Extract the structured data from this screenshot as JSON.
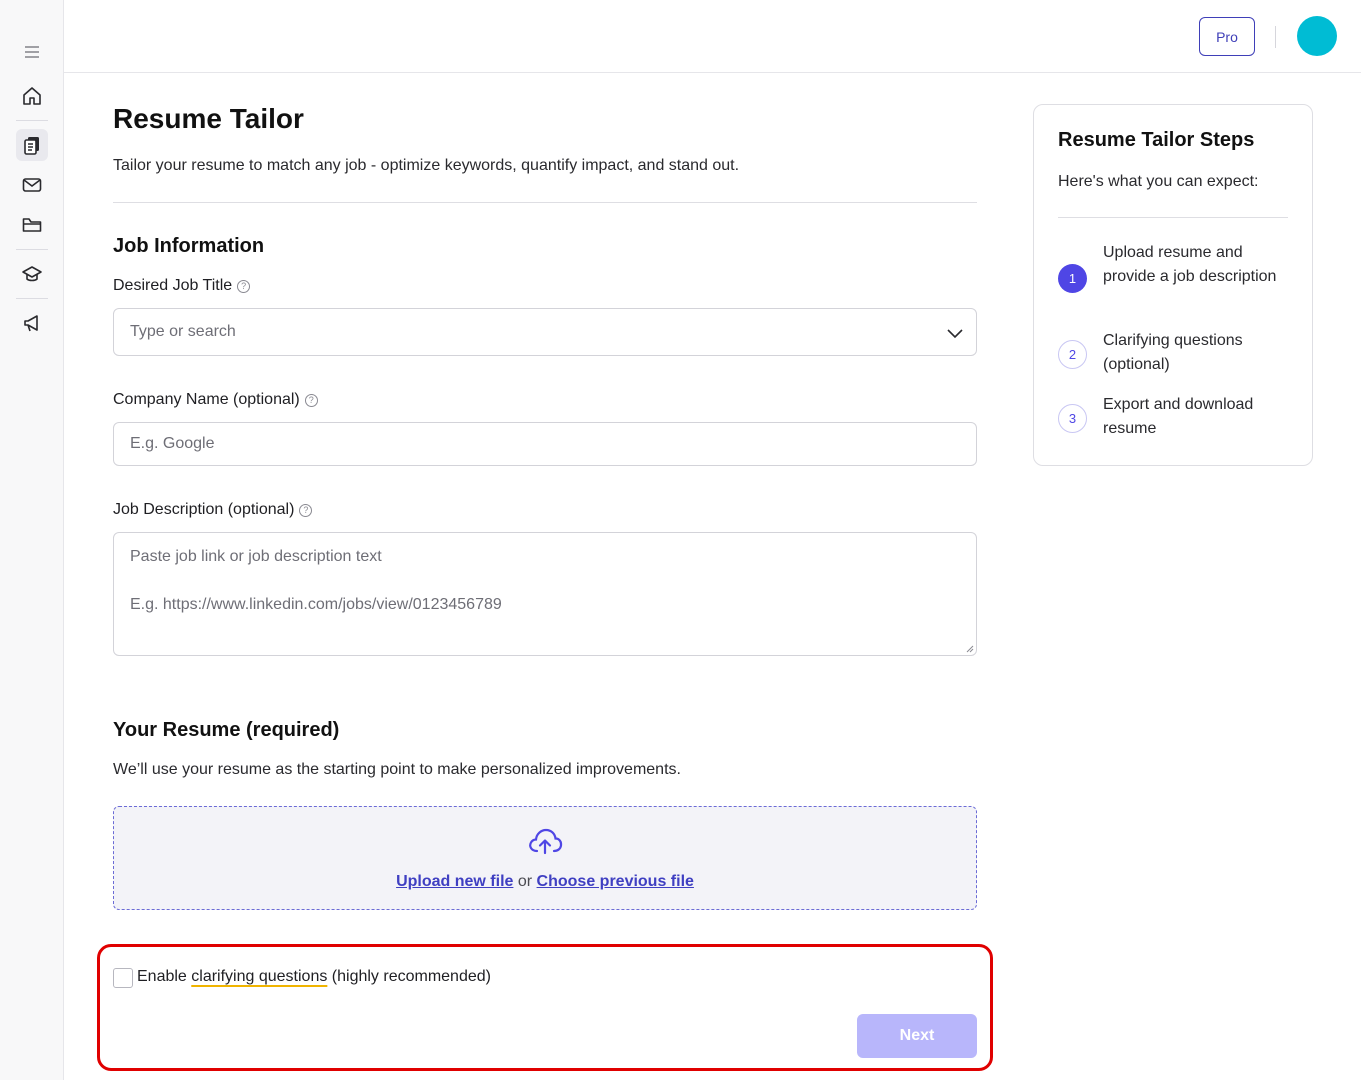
{
  "header": {
    "pro_label": "Pro"
  },
  "sidebar": {
    "items": [
      {
        "icon": "menu-icon"
      },
      {
        "icon": "home-icon"
      },
      {
        "icon": "documents-icon"
      },
      {
        "icon": "mail-icon"
      },
      {
        "icon": "folder-icon"
      },
      {
        "icon": "graduation-cap-icon"
      },
      {
        "icon": "megaphone-icon"
      }
    ]
  },
  "main": {
    "title": "Resume Tailor",
    "subtitle": "Tailor your resume to match any job - optimize keywords, quantify impact, and stand out.",
    "job_section": {
      "heading": "Job Information",
      "job_title_label": "Desired Job Title",
      "job_title_placeholder": "Type or search",
      "company_label": "Company Name (optional)",
      "company_placeholder": "E.g. Google",
      "description_label": "Job Description (optional)",
      "description_placeholder_line1": "Paste job link or job description text",
      "description_placeholder_line2": "E.g. https://www.linkedin.com/jobs/view/0123456789"
    },
    "resume_section": {
      "heading": "Your Resume (required)",
      "description": "We’ll use your resume as the starting point to make personalized improvements.",
      "upload_link": "Upload new file",
      "or_text": " or ",
      "choose_link": "Choose previous file"
    },
    "clarifying": {
      "prefix": "Enable ",
      "highlight": "clarifying questions",
      "suffix": " (highly recommended)",
      "checked": false
    },
    "next_label": "Next"
  },
  "steps_card": {
    "title": "Resume Tailor Steps",
    "subtitle": "Here's what you can expect:",
    "steps": [
      {
        "num": "1",
        "text": "Upload resume and provide a job description",
        "active": true
      },
      {
        "num": "2",
        "text": "Clarifying questions (optional)",
        "active": false
      },
      {
        "num": "3",
        "text": "Export and download resume",
        "active": false
      }
    ]
  },
  "colors": {
    "accent": "#4f46e5",
    "next_disabled": "#b8b6fb",
    "avatar": "#00bcd4",
    "highlight_border": "#e00000"
  }
}
